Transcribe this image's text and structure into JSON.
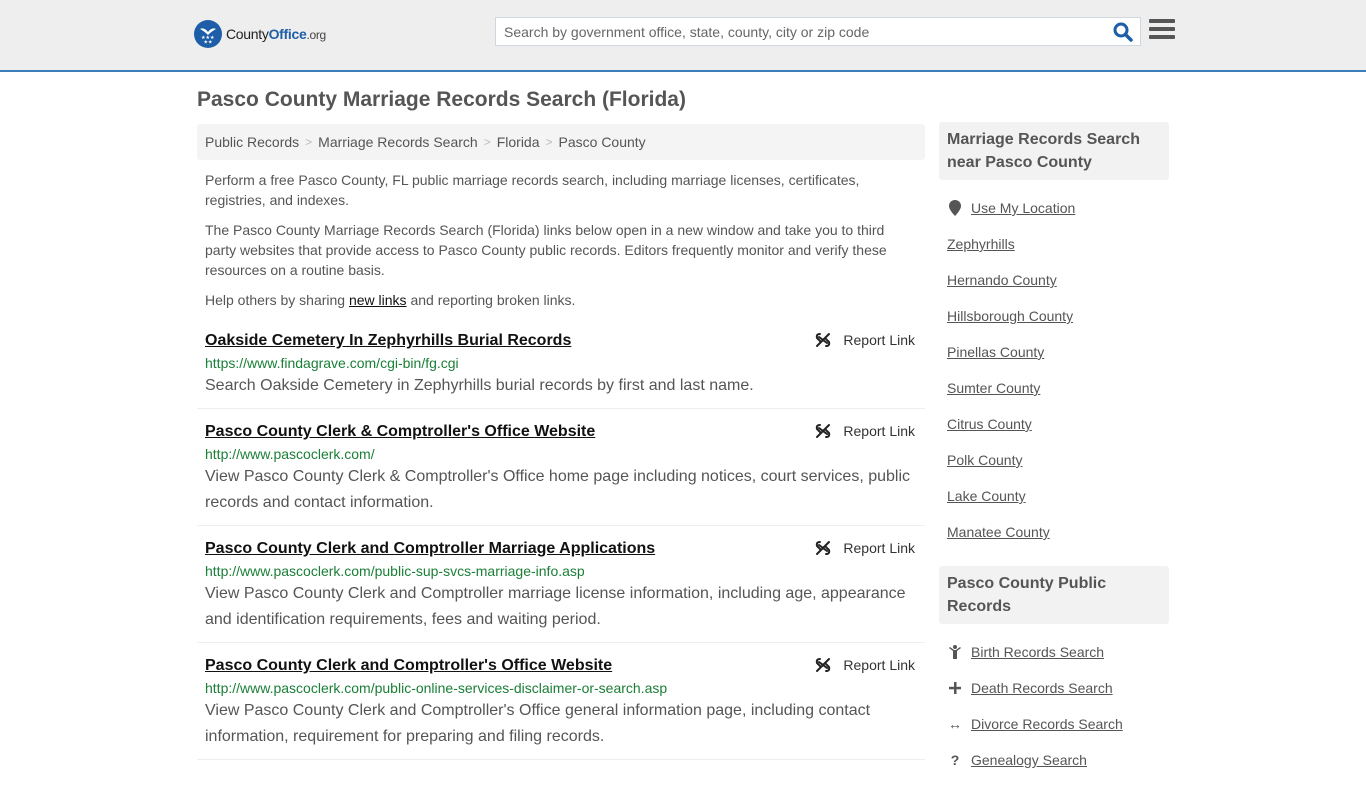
{
  "header": {
    "logo": {
      "county": "County",
      "office": "Office",
      "org": ".org",
      "badge_icon": "eagle-stars-icon"
    },
    "search": {
      "placeholder": "Search by government office, state, county, city or zip code",
      "value": ""
    },
    "colors": {
      "accent": "#3c7dba",
      "brand": "#1e5ea8",
      "header_bg": "#eeeeee"
    }
  },
  "page": {
    "title": "Pasco County Marriage Records Search (Florida)"
  },
  "breadcrumb": [
    {
      "label": "Public Records"
    },
    {
      "label": "Marriage Records Search"
    },
    {
      "label": "Florida"
    },
    {
      "label": "Pasco County"
    }
  ],
  "intro": {
    "p1": "Perform a free Pasco County, FL public marriage records search, including marriage licenses, certificates, registries, and indexes.",
    "p2": "The Pasco County Marriage Records Search (Florida) links below open in a new window and take you to third party websites that provide access to Pasco County public records. Editors frequently monitor and verify these resources on a routine basis.",
    "p3_before": "Help others by sharing ",
    "p3_link": "new links",
    "p3_after": " and reporting broken links."
  },
  "report_label": "Report Link",
  "results": [
    {
      "title": "Oakside Cemetery In Zephyrhills Burial Records",
      "url": "https://www.findagrave.com/cgi-bin/fg.cgi",
      "desc": "Search Oakside Cemetery in Zephyrhills burial records by first and last name."
    },
    {
      "title": "Pasco County Clerk & Comptroller's Office Website",
      "url": "http://www.pascoclerk.com/",
      "desc": "View Pasco County Clerk & Comptroller's Office home page including notices, court services, public records and contact information."
    },
    {
      "title": "Pasco County Clerk and Comptroller Marriage Applications",
      "url": "http://www.pascoclerk.com/public-sup-svcs-marriage-info.asp",
      "desc": "View Pasco County Clerk and Comptroller marriage license information, including age, appearance and identification requirements, fees and waiting period."
    },
    {
      "title": "Pasco County Clerk and Comptroller's Office Website",
      "url": "http://www.pascoclerk.com/public-online-services-disclaimer-or-search.asp",
      "desc": "View Pasco County Clerk and Comptroller's Office general information page, including contact information, requirement for preparing and filing records."
    }
  ],
  "sidebar": {
    "nearby": {
      "heading": "Marriage Records Search near Pasco County",
      "use_location": "Use My Location",
      "items": [
        "Zephyrhills",
        "Hernando County",
        "Hillsborough County",
        "Pinellas County",
        "Sumter County",
        "Citrus County",
        "Polk County",
        "Lake County",
        "Manatee County"
      ]
    },
    "public_records": {
      "heading": "Pasco County Public Records",
      "items": [
        {
          "label": "Birth Records Search",
          "icon": "child-icon"
        },
        {
          "label": "Death Records Search",
          "icon": "cross-icon"
        },
        {
          "label": "Divorce Records Search",
          "icon": "arrows-horizontal-icon"
        },
        {
          "label": "Genealogy Search",
          "icon": "question-icon"
        }
      ]
    }
  }
}
